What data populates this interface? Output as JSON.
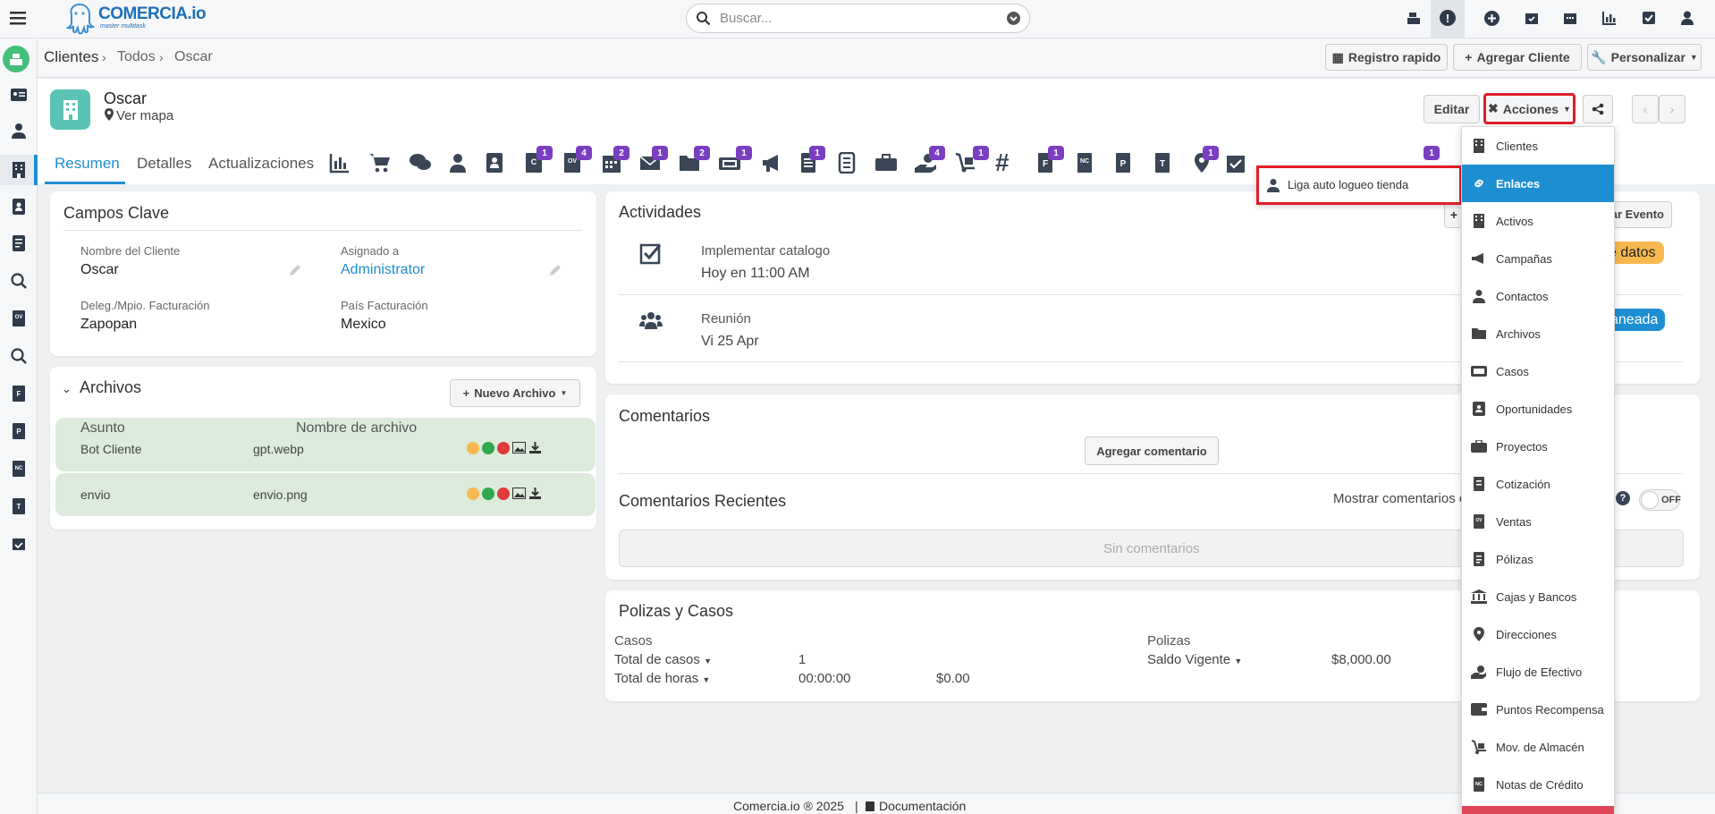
{
  "brand": {
    "name": "COMERCIA.io",
    "tagline": "master multitask"
  },
  "search": {
    "placeholder": "Buscar..."
  },
  "breadcrumb": [
    "Clientes",
    "Todos",
    "Oscar"
  ],
  "header_buttons": {
    "registro": "Registro rapido",
    "agregar": "Agregar Cliente",
    "personalizar": "Personalizar"
  },
  "record": {
    "name": "Oscar",
    "map": "Ver mapa",
    "edit": "Editar",
    "actions": "Acciones"
  },
  "tabs": [
    "Resumen",
    "Detalles",
    "Actualizaciones"
  ],
  "tab_badges": [
    "1",
    "4",
    "2",
    "1",
    "2",
    "1",
    "1",
    "4",
    "1",
    "1",
    "1",
    "1"
  ],
  "key_fields": {
    "title": "Campos Clave",
    "name_label": "Nombre del Cliente",
    "name_value": "Oscar",
    "assigned_label": "Asignado a",
    "assigned_value": "Administrator",
    "municipio_label": "Deleg./Mpio. Facturación",
    "municipio_value": "Zapopan",
    "pais_label": "País Facturación",
    "pais_value": "Mexico"
  },
  "files": {
    "title": "Archivos",
    "new_button": "Nuevo Archivo",
    "col_subject": "Asunto",
    "col_filename": "Nombre de archivo",
    "rows": [
      {
        "subject": "Bot Cliente",
        "file": "gpt.webp"
      },
      {
        "subject": "envio",
        "file": "envio.png"
      }
    ]
  },
  "activities": {
    "title": "Actividades",
    "add_event": "gar Evento",
    "items": [
      {
        "name": "Implementar catalogo",
        "when": "Hoy en 11:00 AM",
        "badge": "e datos"
      },
      {
        "name": "Reunión",
        "when": "Vi 25 Apr",
        "badge": "aneada"
      }
    ]
  },
  "comments": {
    "title": "Comentarios",
    "add": "Agregar comentario",
    "recent": "Comentarios Recientes",
    "show": "Mostrar comentarios c",
    "toggle": "OFF",
    "empty": "Sin comentarios"
  },
  "policies": {
    "title": "Polizas y Casos",
    "casos": "Casos",
    "total_casos": "Total de casos",
    "total_casos_val": "1",
    "total_horas": "Total de horas",
    "total_horas_val": "00:00:00",
    "money": "$0.00",
    "polizas": "Polizas",
    "saldo": "Saldo Vigente",
    "saldo_val": "$8,000.00"
  },
  "submenu": {
    "item": "Liga auto logueo tienda"
  },
  "menu_items": [
    "Clientes",
    "Enlaces",
    "Activos",
    "Campañas",
    "Contactos",
    "Archivos",
    "Casos",
    "Oportunidades",
    "Proyectos",
    "Cotización",
    "Ventas",
    "Pólizas",
    "Cajas y Bancos",
    "Direcciones",
    "Flujo de Efectivo",
    "Puntos Recompensa",
    "Mov. de Almacén",
    "Notas de Crédito"
  ],
  "footer": {
    "copyright": "Comercia.io ® 2025",
    "sep": "|",
    "doc": "Documentación"
  },
  "colors": {
    "accent": "#1e8ed3",
    "highlight": "#e11d2a",
    "badge": "#7a3fc0",
    "file_row": "#dcebdc",
    "warn": "#f7b94f"
  }
}
